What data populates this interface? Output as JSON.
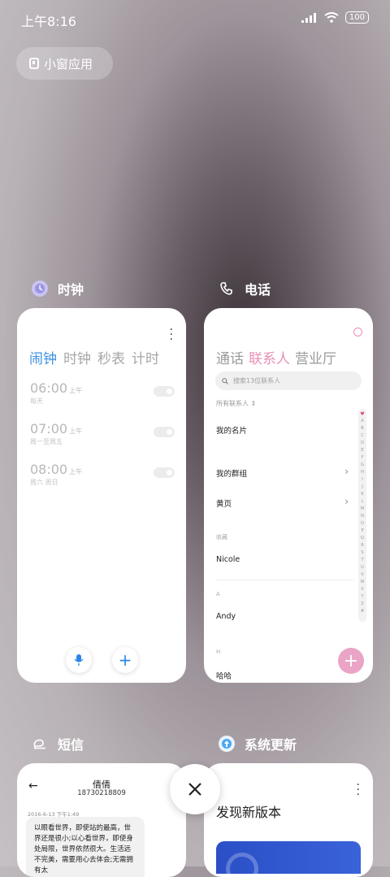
{
  "status": {
    "time": "上午8:16",
    "battery": "100"
  },
  "floating_button": {
    "label": "小窗应用"
  },
  "apps": {
    "clock": {
      "name": "时钟",
      "tabs": [
        "闹钟",
        "时钟",
        "秒表",
        "计时"
      ],
      "alarms": [
        {
          "time": "06:00",
          "ampm": "上午",
          "repeat": "每天"
        },
        {
          "time": "07:00",
          "ampm": "上午",
          "repeat": "周一至周五"
        },
        {
          "time": "08:00",
          "ampm": "上午",
          "repeat": "周六 周日"
        }
      ]
    },
    "phone": {
      "name": "电话",
      "tabs": [
        "通话",
        "联系人",
        "营业厅"
      ],
      "search_placeholder": "搜索13位联系人",
      "all_contacts": "所有联系人",
      "my_card": "我的名片",
      "my_groups": "我的群组",
      "yellow_pages": "黄页",
      "favorites_header": "收藏",
      "favorite_contact": "Nicole",
      "section_a": "A",
      "contact_a": "Andy",
      "section_h": "H",
      "contact_h": "哈哈",
      "index_letters": [
        "A",
        "B",
        "C",
        "D",
        "E",
        "F",
        "G",
        "H",
        "I",
        "J",
        "K",
        "L",
        "M",
        "N",
        "O",
        "P",
        "Q",
        "R",
        "S",
        "T",
        "U",
        "V",
        "W",
        "X",
        "Y",
        "Z",
        "#"
      ]
    },
    "sms": {
      "name": "短信",
      "contact_name": "倩倩",
      "contact_number": "18730218809",
      "date": "2016-6-13 下午1:49",
      "message": "以眼看世界，即使站的最高，世界还是很小;以心看世界，即使身处局限，世界依然很大。生活远不完美，需要用心去体会;无需拥有太"
    },
    "update": {
      "name": "系统更新",
      "title": "发现新版本"
    }
  },
  "colors": {
    "clock_accent": "#3c8fe2",
    "phone_accent": "#e88fb6"
  }
}
